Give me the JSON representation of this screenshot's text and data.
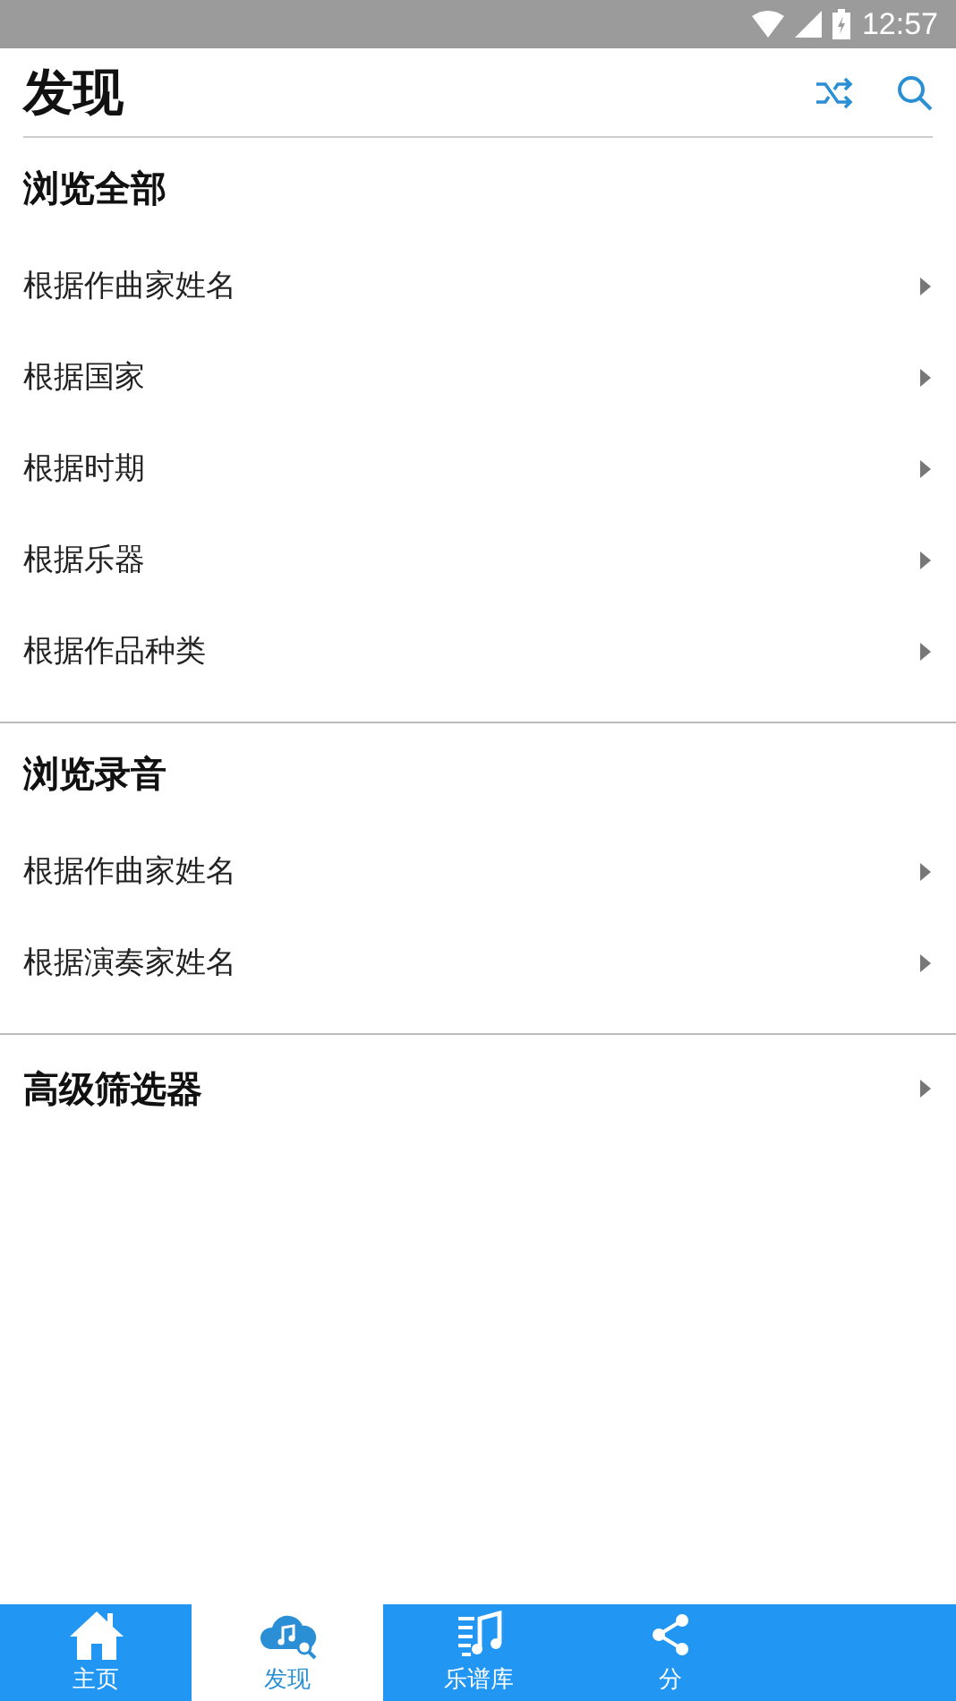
{
  "status_bar": {
    "time": "12:57"
  },
  "header": {
    "title": "发现"
  },
  "sections": [
    {
      "kind": "group",
      "title": "浏览全部",
      "items": [
        {
          "label": "根据作曲家姓名"
        },
        {
          "label": "根据国家"
        },
        {
          "label": "根据时期"
        },
        {
          "label": "根据乐器"
        },
        {
          "label": "根据作品种类"
        }
      ]
    },
    {
      "kind": "group",
      "title": "浏览录音",
      "items": [
        {
          "label": "根据作曲家姓名"
        },
        {
          "label": "根据演奏家姓名"
        }
      ]
    },
    {
      "kind": "link",
      "title": "高级筛选器"
    }
  ],
  "tab_bar": [
    {
      "label": "主页",
      "selected": false
    },
    {
      "label": "发现",
      "selected": true
    },
    {
      "label": "乐谱库",
      "selected": false
    },
    {
      "label": "分",
      "selected": false
    }
  ]
}
